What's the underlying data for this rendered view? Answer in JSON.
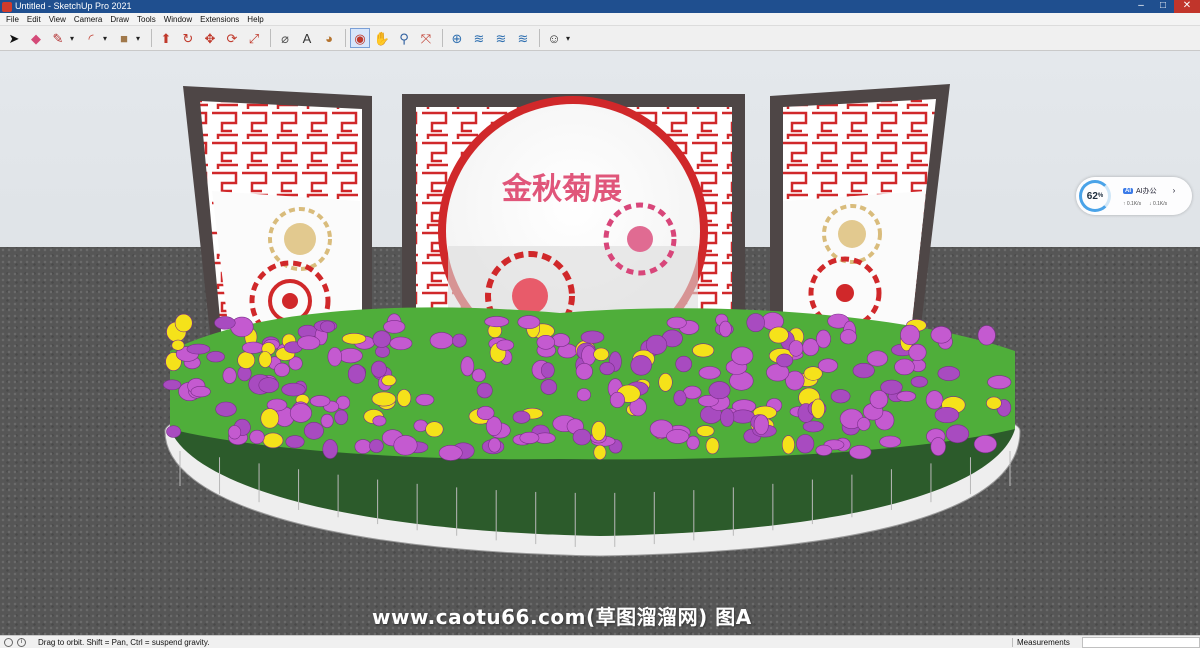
{
  "window": {
    "title": "Untitled - SketchUp Pro 2021",
    "minimize": "–",
    "maximize": "□",
    "close": "✕"
  },
  "menu": [
    "File",
    "Edit",
    "View",
    "Camera",
    "Draw",
    "Tools",
    "Window",
    "Extensions",
    "Help"
  ],
  "toolbar": {
    "tools": [
      {
        "name": "select-tool",
        "glyph": "➤",
        "color": "#111111"
      },
      {
        "name": "eraser-tool",
        "glyph": "◆",
        "color": "#d44a78"
      },
      {
        "name": "line-tool",
        "glyph": "✎",
        "color": "#b12b2b",
        "dropdown": true
      },
      {
        "name": "arc-tool",
        "glyph": "◜",
        "color": "#c0392b",
        "dropdown": true
      },
      {
        "name": "shape-tool",
        "glyph": "■",
        "color": "#a0784a",
        "dropdown": true
      },
      {
        "name": "push-pull-tool",
        "glyph": "⬆",
        "color": "#c0392b"
      },
      {
        "name": "follow-me-tool",
        "glyph": "↻",
        "color": "#c0392b"
      },
      {
        "name": "move-tool",
        "glyph": "✥",
        "color": "#c0392b"
      },
      {
        "name": "rotate-tool",
        "glyph": "⟳",
        "color": "#c0392b"
      },
      {
        "name": "scale-tool",
        "glyph": "⤢",
        "color": "#c0392b"
      },
      {
        "name": "tape-measure-tool",
        "glyph": "⌀",
        "color": "#555555"
      },
      {
        "name": "text-tool",
        "glyph": "A",
        "color": "#333333"
      },
      {
        "name": "paint-bucket-tool",
        "glyph": "◕",
        "color": "#b5742f"
      },
      {
        "name": "orbit-tool",
        "glyph": "◉",
        "color": "#c0392b",
        "active": true
      },
      {
        "name": "pan-tool",
        "glyph": "✋",
        "color": "#b5742f"
      },
      {
        "name": "zoom-tool",
        "glyph": "⚲",
        "color": "#2f5f9f"
      },
      {
        "name": "zoom-extents-tool",
        "glyph": "⤧",
        "color": "#c0392b"
      },
      {
        "name": "add-location-tool",
        "glyph": "⊕",
        "color": "#2f6fb0"
      },
      {
        "name": "3d-warehouse-tool",
        "glyph": "≋",
        "color": "#2f6fb0"
      },
      {
        "name": "extension-warehouse-tool",
        "glyph": "≋",
        "color": "#2f6fb0"
      },
      {
        "name": "layout-tool",
        "glyph": "≋",
        "color": "#2f6fb0"
      },
      {
        "name": "account-tool",
        "glyph": "☺",
        "color": "#333333",
        "dropdown": true
      }
    ]
  },
  "scene": {
    "sign_text": "金秋菊展"
  },
  "watermark": "www.caotu66.com(草图溜溜网) 图A",
  "widget": {
    "percent": "62",
    "percent_sign": "%",
    "ai_badge": "AI",
    "ai_label": "AI办公",
    "chevron": "›",
    "upload": "↑ 0.1K/s",
    "download": "↓ 0.1K/s"
  },
  "status": {
    "message": "Drag to orbit. Shift = Pan, Ctrl = suspend gravity.",
    "measurements_label": "Measurements"
  }
}
